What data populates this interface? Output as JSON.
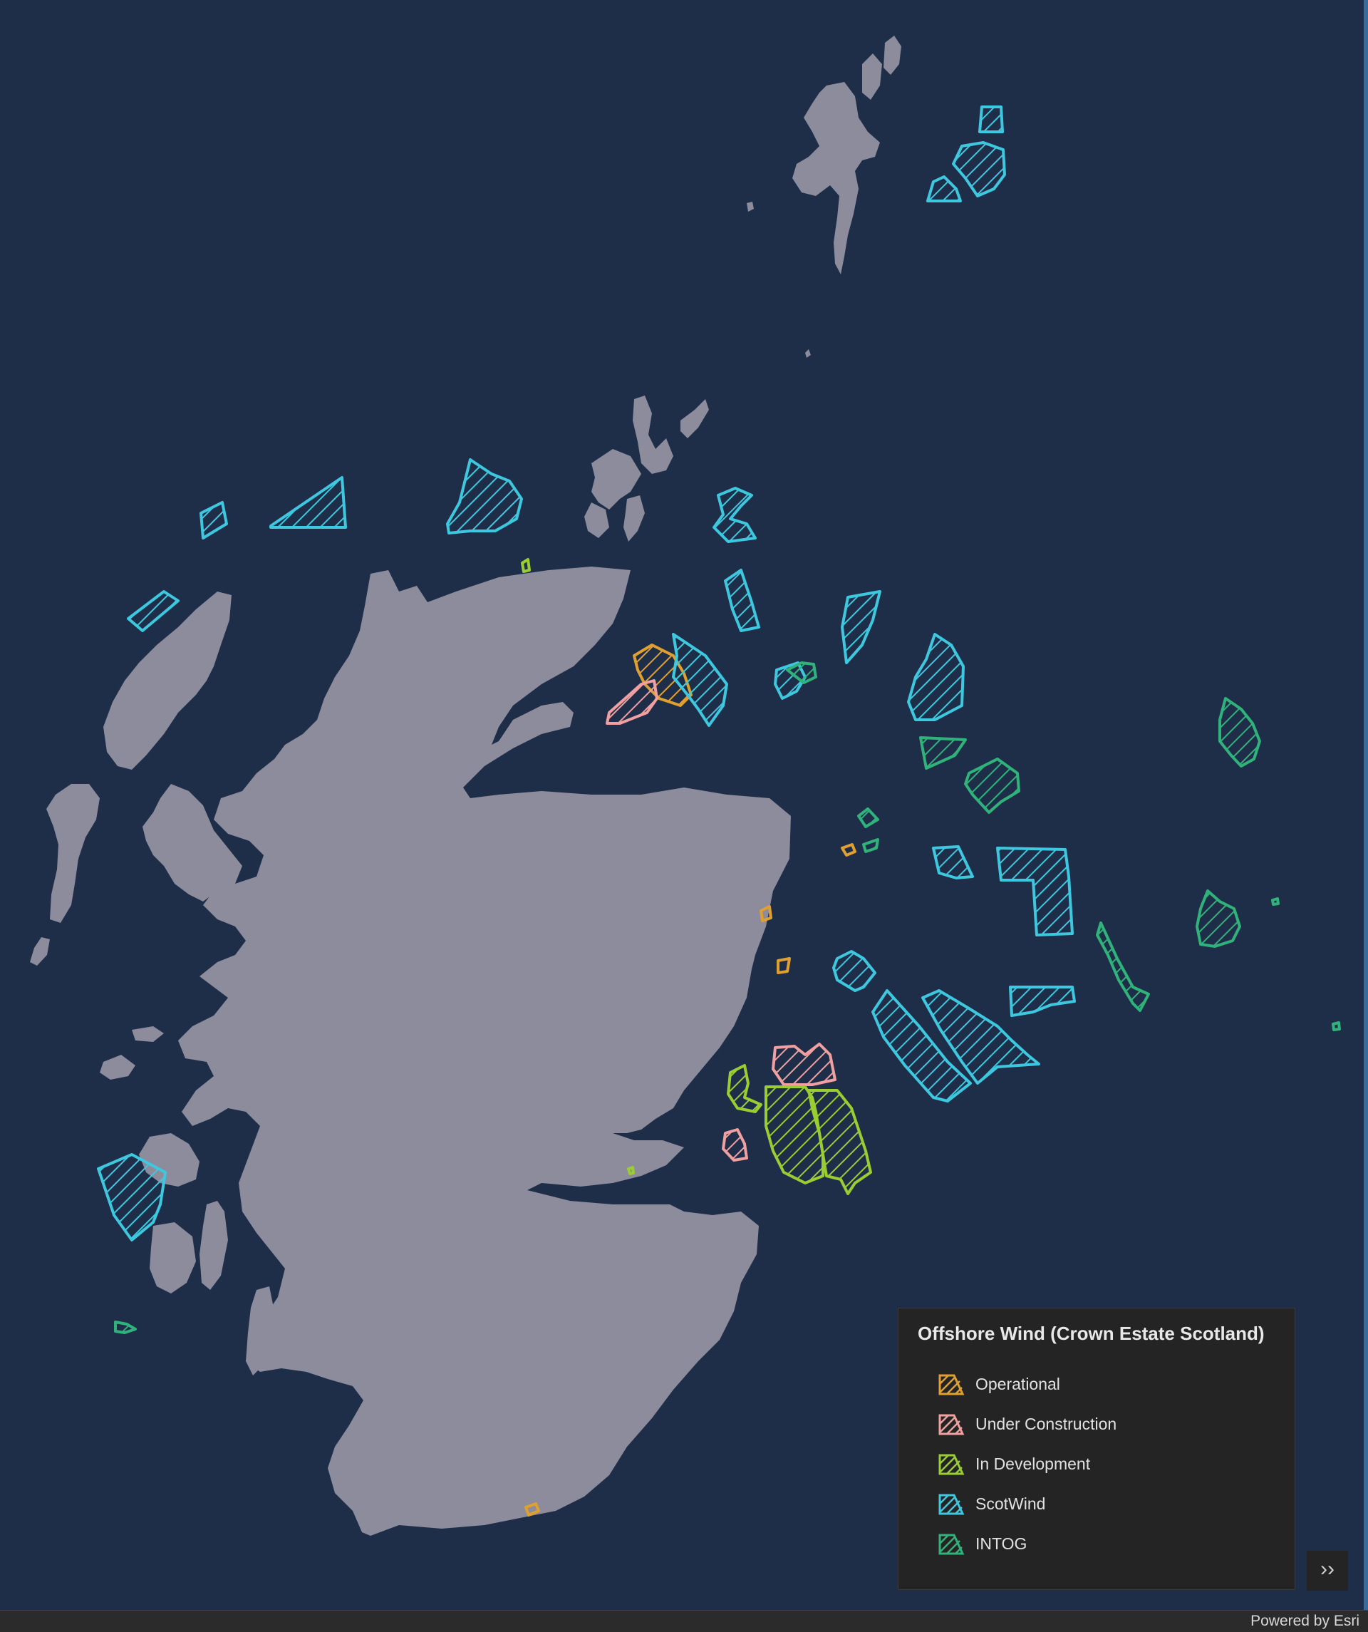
{
  "map": {
    "background_color": "#1e2e48",
    "land_color": "#8c8c9c"
  },
  "legend": {
    "title": "Offshore Wind (Crown Estate Scotland)",
    "items": [
      {
        "label": "Operational",
        "color": "#e0a030"
      },
      {
        "label": "Under Construction",
        "color": "#f0a0a0"
      },
      {
        "label": "In Development",
        "color": "#9acd32"
      },
      {
        "label": "ScotWind",
        "color": "#3ec8e0"
      },
      {
        "label": "INTOG",
        "color": "#2fb37a"
      }
    ]
  },
  "controls": {
    "expand_label": "››",
    "expand_icon": "chevron-double-right-icon"
  },
  "attribution": {
    "text": "Powered by Esri"
  }
}
